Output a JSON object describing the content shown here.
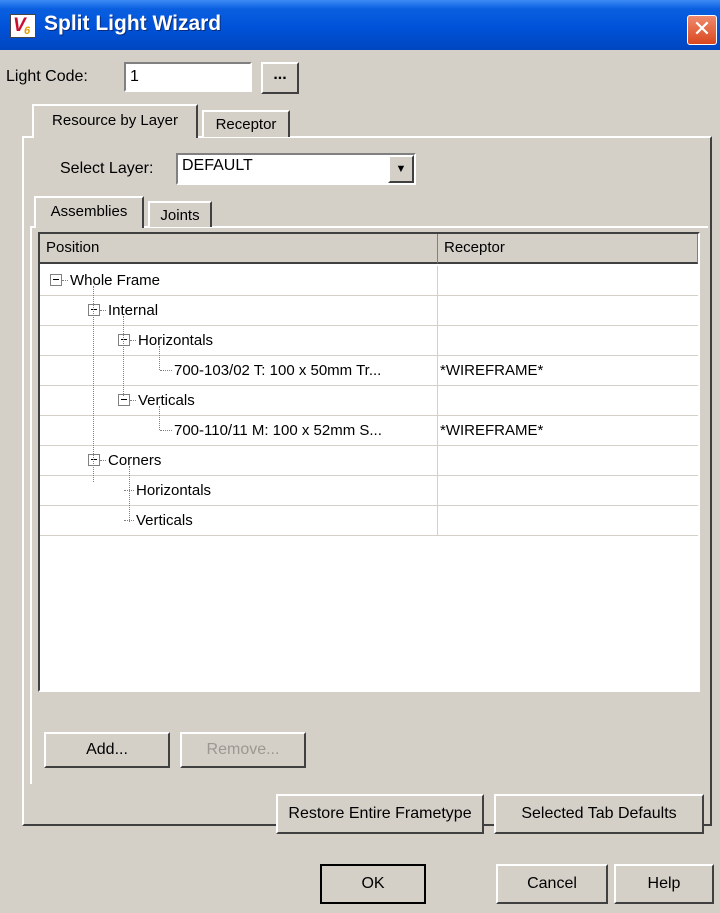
{
  "window": {
    "title": "Split Light Wizard",
    "logo_text": "V",
    "logo_sub": "6",
    "close_glyph": "✕"
  },
  "light_code": {
    "label": "Light Code:",
    "value": "1",
    "browse_label": "..."
  },
  "outer_tabs": [
    {
      "label": "Resource by Layer"
    },
    {
      "label": "Receptor"
    }
  ],
  "select_layer": {
    "label": "Select Layer:",
    "value": "DEFAULT"
  },
  "inner_tabs": [
    {
      "label": "Assemblies"
    },
    {
      "label": "Joints"
    }
  ],
  "grid": {
    "columns": [
      {
        "label": "Position"
      },
      {
        "label": "Receptor"
      }
    ],
    "rows": [
      {
        "position": "Whole Frame",
        "receptor": ""
      },
      {
        "position": "Internal",
        "receptor": ""
      },
      {
        "position": "Horizontals",
        "receptor": ""
      },
      {
        "position": "700-103/02 T: 100 x 50mm Tr...",
        "receptor": "*WIREFRAME*"
      },
      {
        "position": "Verticals",
        "receptor": ""
      },
      {
        "position": "700-110/11 M: 100 x 52mm S...",
        "receptor": "*WIREFRAME*"
      },
      {
        "position": "Corners",
        "receptor": ""
      },
      {
        "position": "Horizontals",
        "receptor": ""
      },
      {
        "position": "Verticals",
        "receptor": ""
      }
    ]
  },
  "buttons": {
    "add": "Add...",
    "remove": "Remove...",
    "restore": "Restore Entire Frametype",
    "selected_defaults": "Selected Tab Defaults",
    "ok": "OK",
    "cancel": "Cancel",
    "help": "Help"
  },
  "dropdown_glyph": "▼",
  "colors": {
    "titlebar": "#0052d8",
    "face": "#d4d0c8",
    "close": "#d9471f"
  }
}
